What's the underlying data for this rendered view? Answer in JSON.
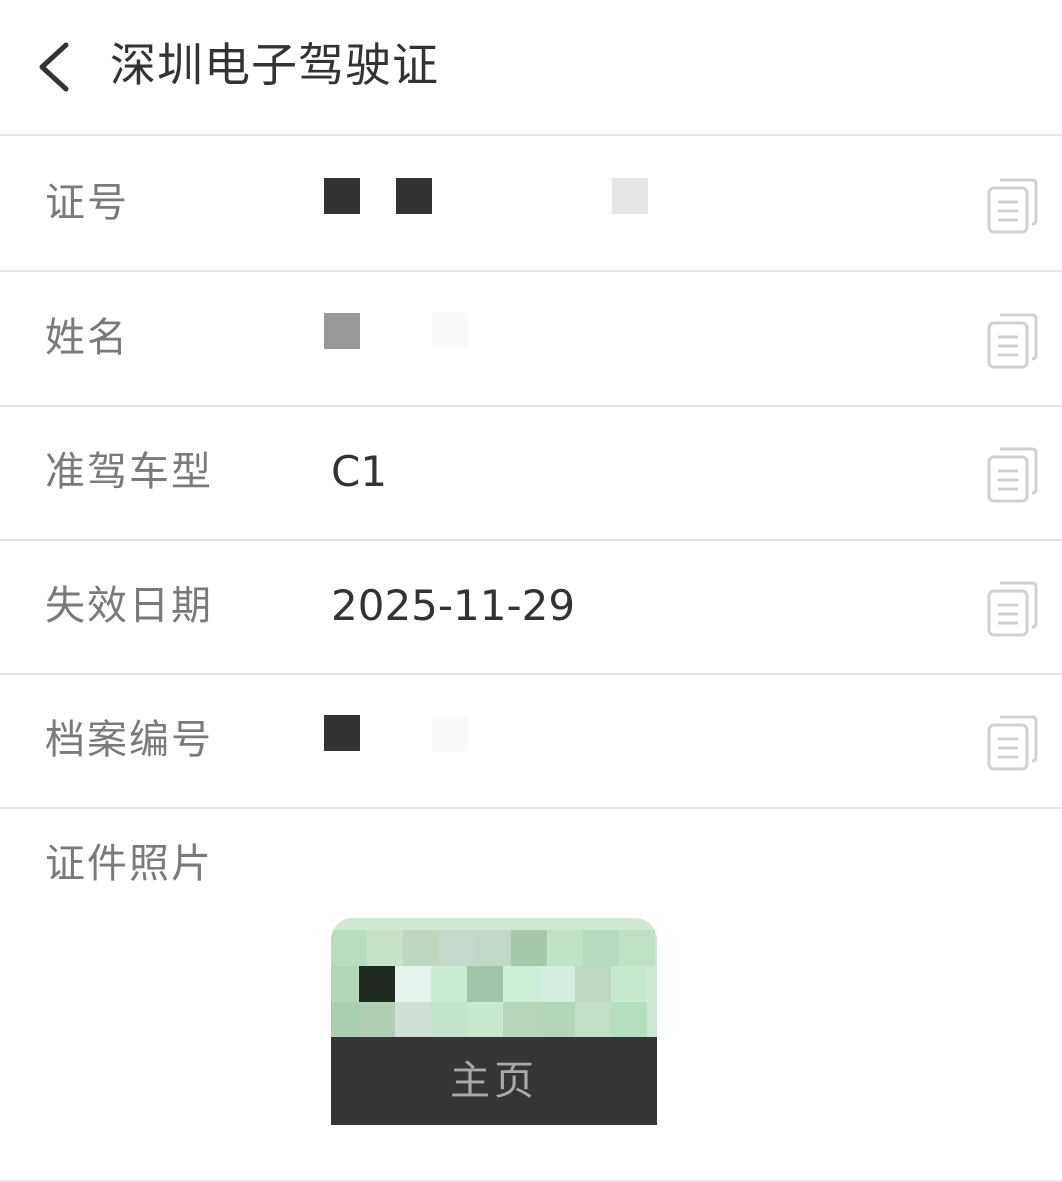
{
  "header": {
    "title": "深圳电子驾驶证",
    "back_icon": "chevron-left-icon"
  },
  "rows": [
    {
      "label": "证号",
      "value": "",
      "redacted": true
    },
    {
      "label": "姓名",
      "value": "",
      "redacted": true
    },
    {
      "label": "准驾车型",
      "value": "C1",
      "redacted": false
    },
    {
      "label": "失效日期",
      "value": "2025-11-29",
      "redacted": false
    },
    {
      "label": "档案编号",
      "value": "",
      "redacted": true
    }
  ],
  "photo_section": {
    "label": "证件照片",
    "button_label": "主页"
  },
  "icons": {
    "copy": "copy-icon"
  },
  "colors": {
    "label": "#7a7a7a",
    "text": "#333333",
    "divider": "#e6e6e6",
    "button_bg": "#353535",
    "button_text": "#a9a9a9",
    "redaction_dark": "#333333",
    "redaction_gray": "#999999",
    "redaction_light": "#e6e6e6"
  }
}
